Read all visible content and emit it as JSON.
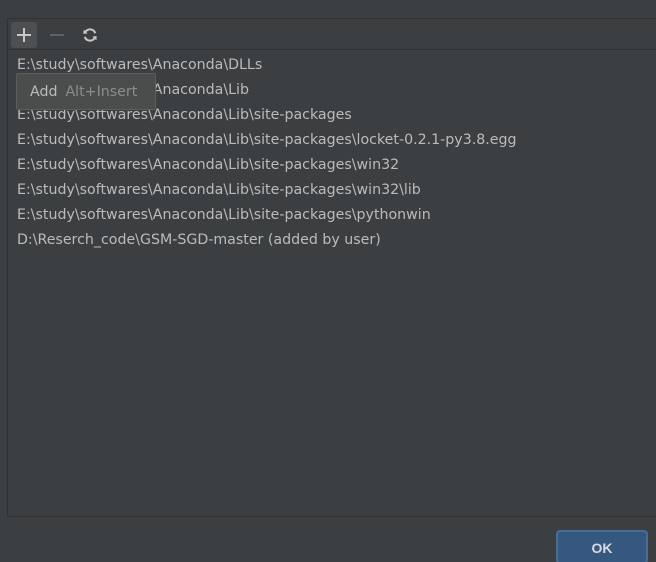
{
  "toolbar": {
    "add_icon": "plus-icon",
    "remove_icon": "minus-icon",
    "refresh_icon": "refresh-icon"
  },
  "tooltip": {
    "action": "Add",
    "shortcut": "Alt+Insert"
  },
  "paths": [
    "E:\\study\\softwares\\Anaconda\\DLLs",
    "E:\\study\\softwares\\Anaconda\\Lib",
    "E:\\study\\softwares\\Anaconda\\Lib\\site-packages",
    "E:\\study\\softwares\\Anaconda\\Lib\\site-packages\\locket-0.2.1-py3.8.egg",
    "E:\\study\\softwares\\Anaconda\\Lib\\site-packages\\win32",
    "E:\\study\\softwares\\Anaconda\\Lib\\site-packages\\win32\\lib",
    "E:\\study\\softwares\\Anaconda\\Lib\\site-packages\\pythonwin",
    "D:\\Reserch_code\\GSM-SGD-master  (added by user)"
  ],
  "buttons": {
    "ok_label": "OK"
  },
  "colors": {
    "background": "#3c3f41",
    "text": "#bbbbbb",
    "ok_button": "#365880",
    "icon_active": "#c8c8c8",
    "icon_disabled": "#5f6366"
  }
}
